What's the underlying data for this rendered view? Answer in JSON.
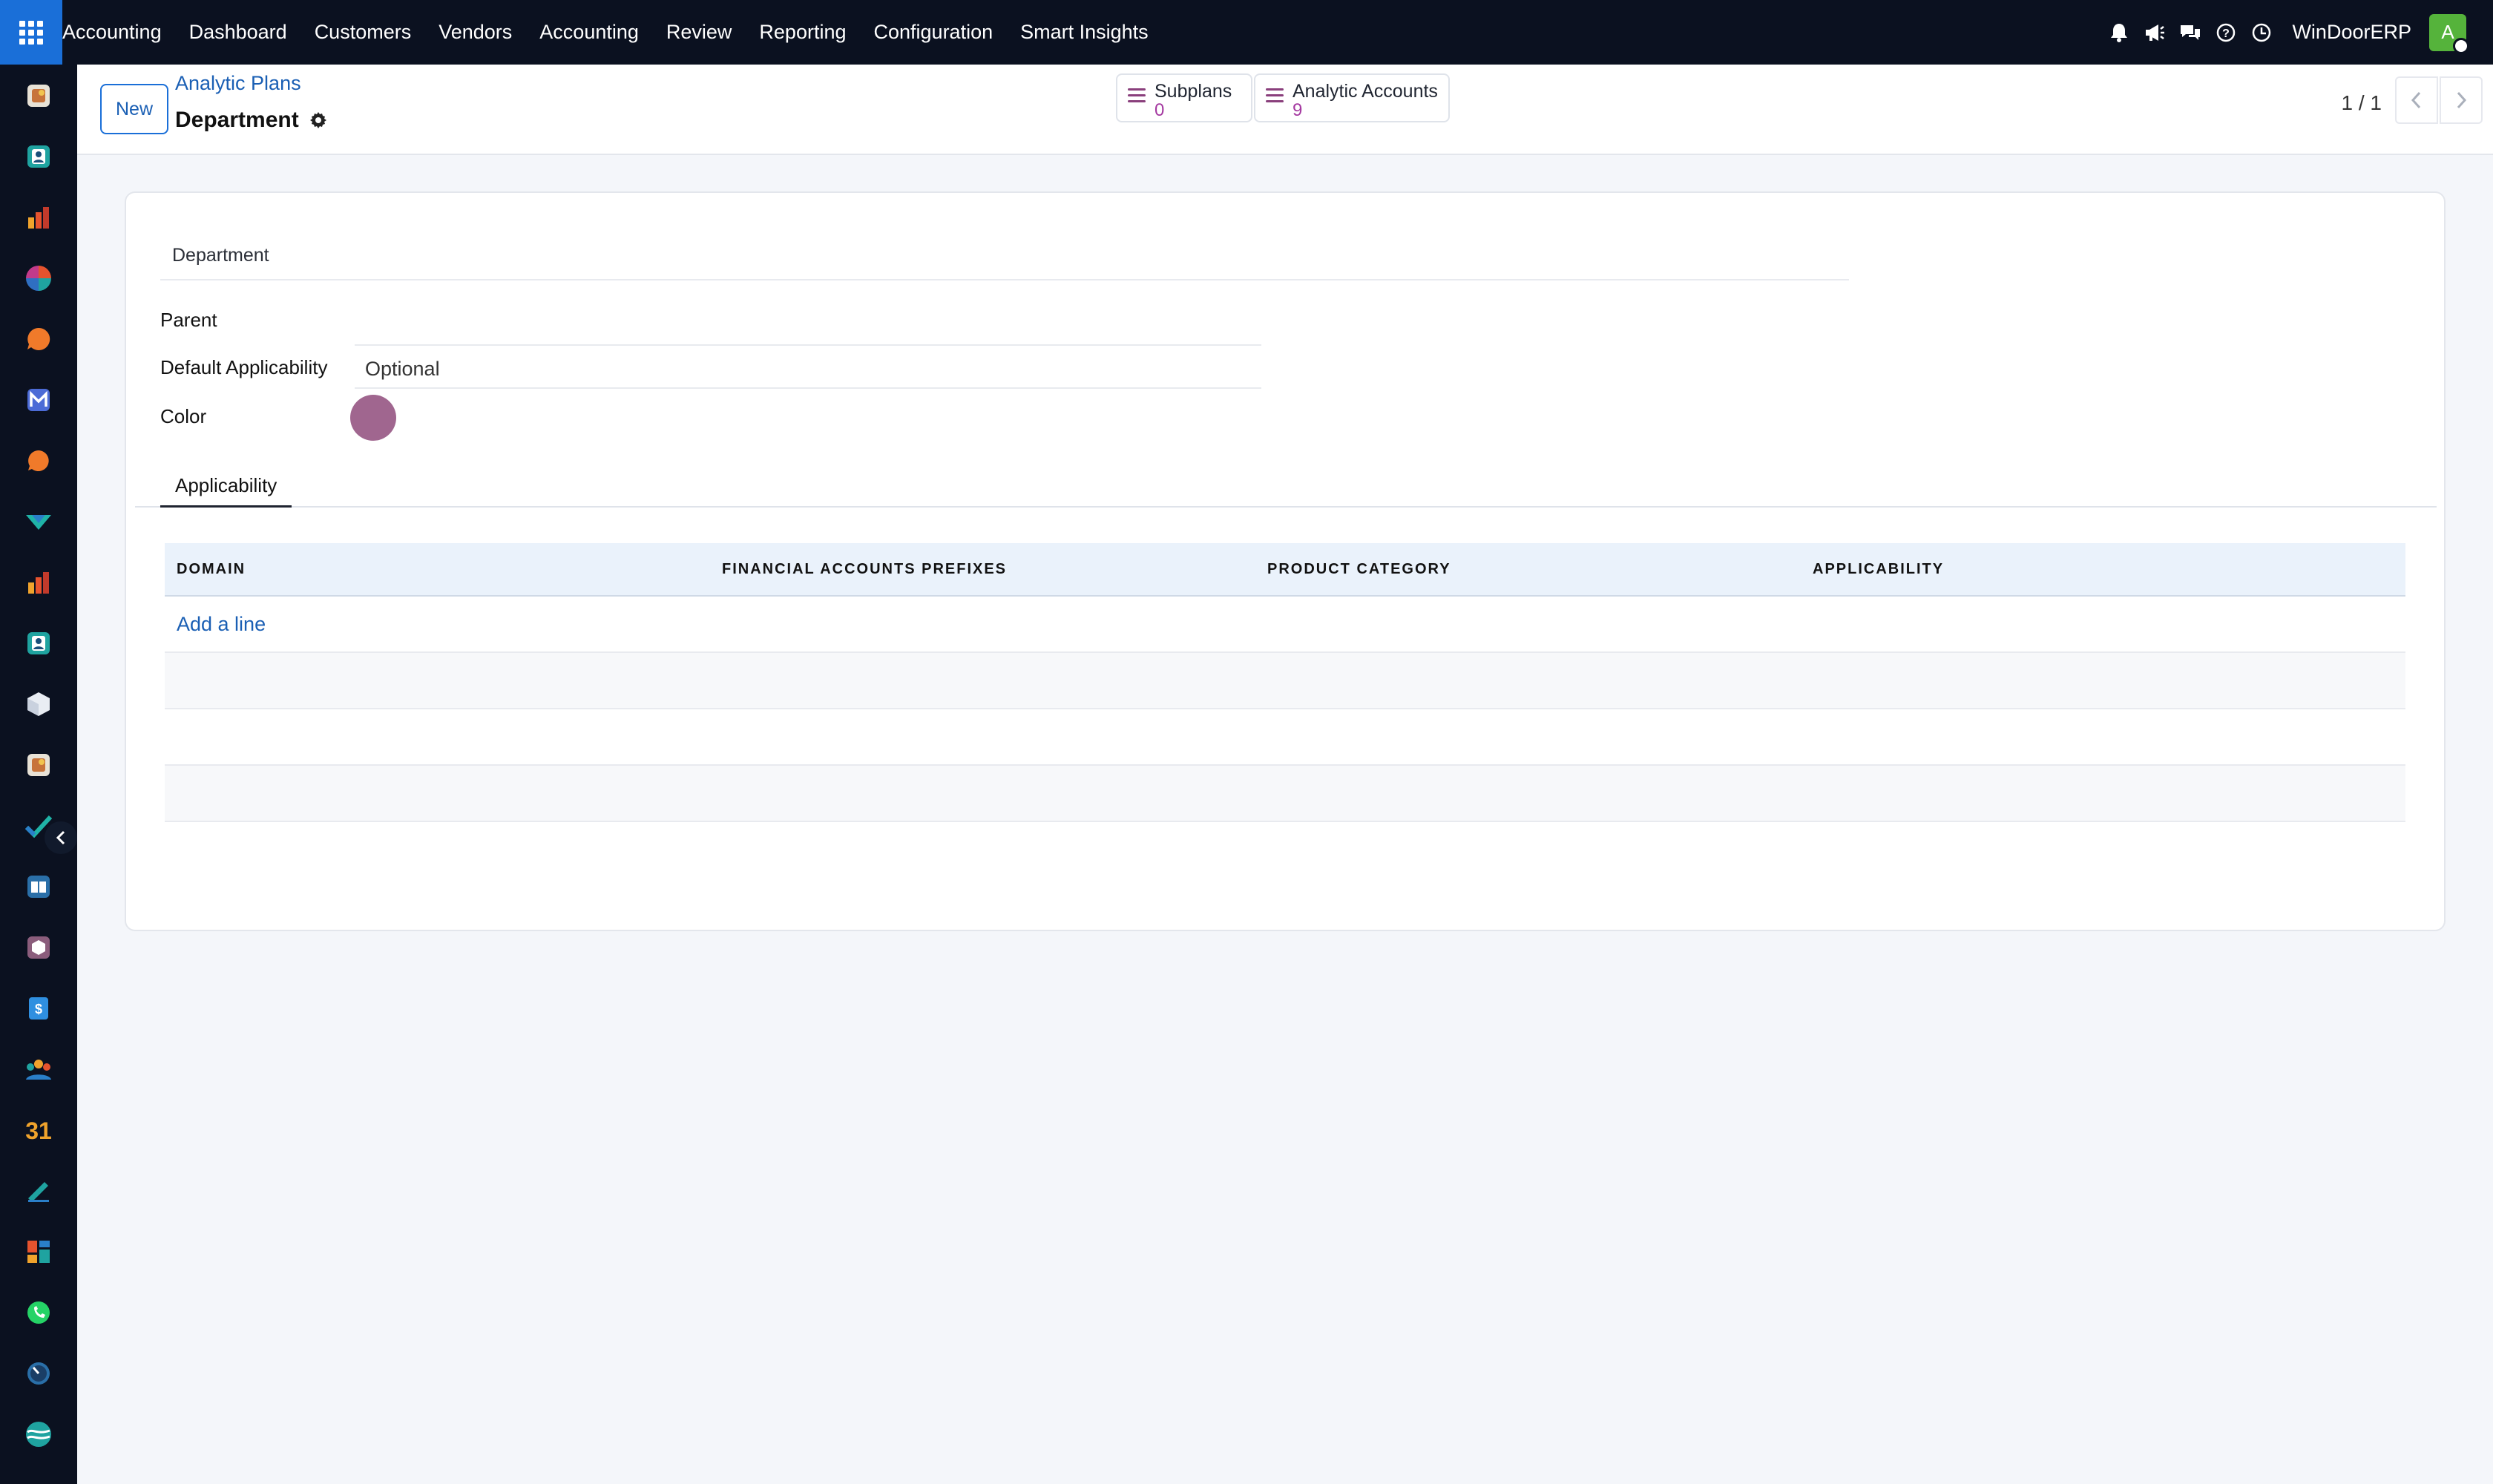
{
  "navbar": {
    "brand": "Accounting",
    "menu": [
      "Dashboard",
      "Customers",
      "Vendors",
      "Accounting",
      "Review",
      "Reporting",
      "Configuration",
      "Smart Insights"
    ],
    "company": "WinDoorERP",
    "avatar_initial": "A"
  },
  "control_panel": {
    "new_label": "New",
    "breadcrumb": "Analytic Plans",
    "record_title": "Department",
    "smart_buttons": [
      {
        "label": "Subplans",
        "count": "0"
      },
      {
        "label": "Analytic Accounts",
        "count": "9"
      }
    ],
    "pager": "1 / 1"
  },
  "form": {
    "name_value": "Department",
    "fields": {
      "parent_label": "Parent",
      "parent_value": "",
      "default_applicability_label": "Default Applicability",
      "default_applicability_value": "Optional",
      "color_label": "Color",
      "color_value": "#a0668f"
    },
    "tabs": [
      "Applicability"
    ],
    "table": {
      "columns": [
        "DOMAIN",
        "FINANCIAL ACCOUNTS PREFIXES",
        "PRODUCT CATEGORY",
        "APPLICABILITY"
      ],
      "add_line_label": "Add a line"
    }
  },
  "colors": {
    "navbar_bg": "#0b1120",
    "accent": "#1a6fd8",
    "link": "#1a5fb4",
    "smart_count": "#a438a0"
  },
  "sidebar_icons": [
    "gift-card-icon",
    "contacts-icon",
    "bar-chart-icon",
    "pie-chart-icon",
    "chat-bubble-icon",
    "mail-icon",
    "discuss-icon",
    "inventory-check-icon",
    "bar-chart-icon-2",
    "contacts-icon-2",
    "package-icon",
    "gift-card-icon-2",
    "checkmark-icon",
    "knowledge-book-icon",
    "cube-icon",
    "expense-icon",
    "employees-icon",
    "calendar-icon",
    "sign-icon",
    "dashboard-icon",
    "whatsapp-icon",
    "timer-icon",
    "wave-icon"
  ]
}
